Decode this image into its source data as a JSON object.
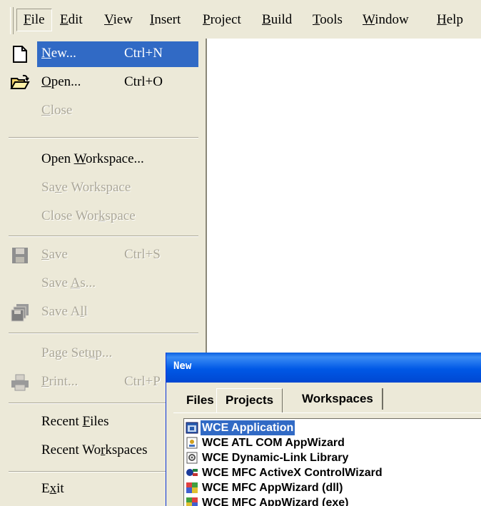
{
  "menubar": {
    "items": [
      {
        "pre": "",
        "ul": "F",
        "post": "ile"
      },
      {
        "pre": "",
        "ul": "E",
        "post": "dit"
      },
      {
        "pre": "",
        "ul": "V",
        "post": "iew"
      },
      {
        "pre": "",
        "ul": "I",
        "post": "nsert"
      },
      {
        "pre": "",
        "ul": "P",
        "post": "roject"
      },
      {
        "pre": "",
        "ul": "B",
        "post": "uild"
      },
      {
        "pre": "",
        "ul": "T",
        "post": "ools"
      },
      {
        "pre": "",
        "ul": "W",
        "post": "indow"
      },
      {
        "pre": "",
        "ul": "H",
        "post": "elp"
      }
    ]
  },
  "file_menu": {
    "new": {
      "pre": "",
      "ul": "N",
      "post": "ew...",
      "shortcut": "Ctrl+N",
      "enabled": true,
      "highlighted": true,
      "icon": "new-document-icon"
    },
    "open": {
      "pre": "",
      "ul": "O",
      "post": "pen...",
      "shortcut": "Ctrl+O",
      "enabled": true,
      "icon": "open-folder-icon"
    },
    "close": {
      "pre": "",
      "ul": "C",
      "post": "lose",
      "enabled": false
    },
    "open_workspace": {
      "pre": "Open ",
      "ul": "W",
      "post": "orkspace...",
      "enabled": true
    },
    "save_workspace": {
      "pre": "Sa",
      "ul": "v",
      "post": "e Workspace",
      "enabled": false
    },
    "close_workspace": {
      "pre": "Close Wor",
      "ul": "k",
      "post": "space",
      "enabled": false
    },
    "save": {
      "pre": "",
      "ul": "S",
      "post": "ave",
      "shortcut": "Ctrl+S",
      "enabled": false,
      "icon": "floppy-disk-icon"
    },
    "save_as": {
      "pre": "Save ",
      "ul": "A",
      "post": "s...",
      "enabled": false
    },
    "save_all": {
      "pre": "Save A",
      "ul": "l",
      "post": "l",
      "enabled": false,
      "icon": "save-all-icon"
    },
    "page_setup": {
      "pre": "Page Set",
      "ul": "u",
      "post": "p...",
      "enabled": false
    },
    "print": {
      "pre": "",
      "ul": "P",
      "post": "rint...",
      "shortcut": "Ctrl+P",
      "enabled": false,
      "icon": "printer-icon"
    },
    "recent_files": {
      "pre": "Recent ",
      "ul": "F",
      "post": "iles",
      "enabled": true
    },
    "recent_workspaces": {
      "pre": "Recent Wo",
      "ul": "r",
      "post": "kspaces",
      "enabled": true
    },
    "exit": {
      "pre": "E",
      "ul": "x",
      "post": "it",
      "enabled": true
    }
  },
  "new_dialog": {
    "title": "New",
    "tabs": [
      "Files",
      "Projects",
      "Workspaces"
    ],
    "active_tab": "Projects",
    "projects": [
      {
        "label": "WCE Application",
        "selected": true
      },
      {
        "label": "WCE ATL COM AppWizard"
      },
      {
        "label": "WCE Dynamic-Link Library"
      },
      {
        "label": "WCE MFC ActiveX ControlWizard"
      },
      {
        "label": "WCE MFC AppWizard (dll)"
      },
      {
        "label": "WCE MFC AppWizard (exe)"
      }
    ]
  },
  "colors": {
    "menu_bg": "#ece9d8",
    "highlight": "#316ac5",
    "disabled_text": "#aca899",
    "titlebar": "#0058e6"
  }
}
